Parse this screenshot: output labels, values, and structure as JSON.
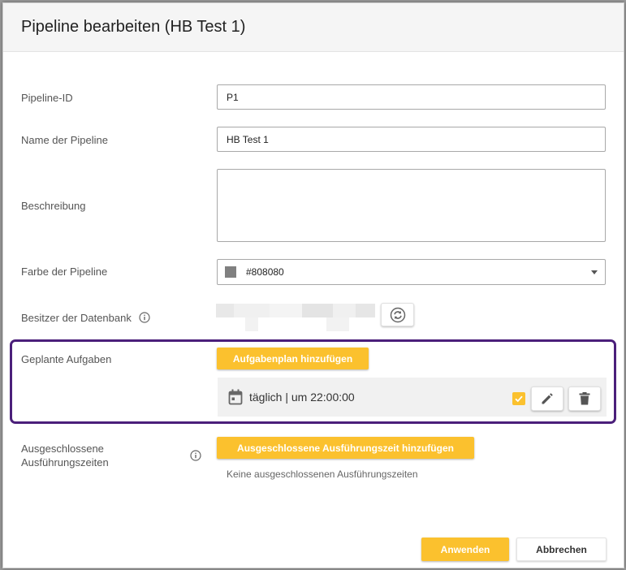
{
  "dialog": {
    "title": "Pipeline bearbeiten (HB Test 1)"
  },
  "form": {
    "pipeline_id": {
      "label": "Pipeline-ID",
      "value": "P1"
    },
    "name": {
      "label": "Name der Pipeline",
      "value": "HB Test 1"
    },
    "description": {
      "label": "Beschreibung",
      "value": ""
    },
    "color": {
      "label": "Farbe der Pipeline",
      "value": "#808080",
      "swatch": "#808080"
    },
    "owner": {
      "label": "Besitzer der Datenbank",
      "info_icon": "info-icon",
      "reload_icon": "sync-icon"
    }
  },
  "scheduled": {
    "label": "Geplante Aufgaben",
    "add_button": "Aufgabenplan hinzufügen",
    "items": [
      {
        "icon": "calendar-icon",
        "text": "täglich | um 22:00:00",
        "enabled": true
      }
    ]
  },
  "excluded": {
    "label_line1": "Ausgeschlossene",
    "label_line2": "Ausführungszeiten",
    "add_button": "Ausgeschlossene Ausführungszeit hinzufügen",
    "empty_text": "Keine ausgeschlossenen Ausführungszeiten"
  },
  "footer": {
    "apply": "Anwenden",
    "cancel": "Abbrechen"
  },
  "colors": {
    "accent": "#fbc12e",
    "highlight": "#4b1f7a"
  }
}
